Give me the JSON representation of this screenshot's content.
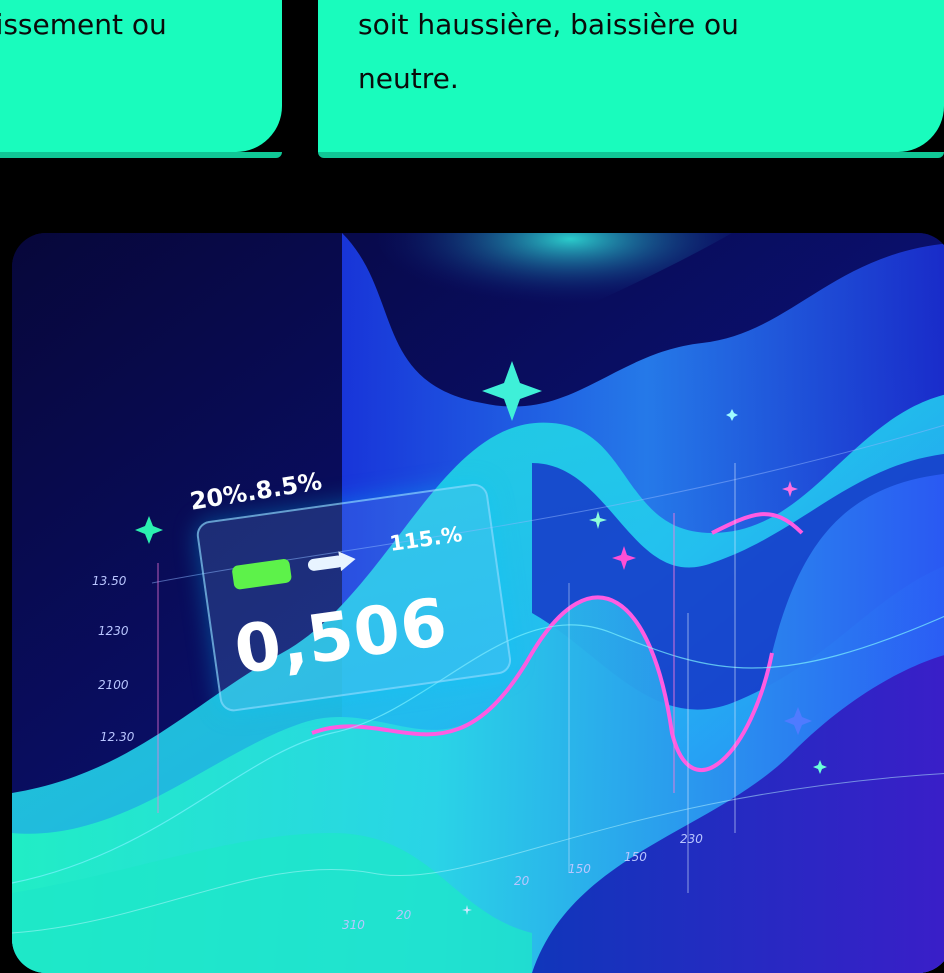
{
  "cards": {
    "left_text": "stissement ou",
    "right_line1": "soit haussière, baissière ou",
    "right_line2": "neutre."
  },
  "illustration": {
    "headline_value": "0,506",
    "top_label": "20%.8.5%",
    "card_percent": "115.%",
    "y_ticks": [
      "13.50",
      "1230",
      "2100",
      "12.30"
    ],
    "x_ticks": [
      "310",
      "20",
      "20",
      "150",
      "150",
      "230"
    ],
    "colors": {
      "card_accent": "#19fcbd",
      "wave_cyan": "#22e8d8",
      "wave_blue": "#1f5cff",
      "wave_violet": "#5a1fd9",
      "curve_pink": "#ff5ce2",
      "pill_green": "#5df24a"
    }
  }
}
